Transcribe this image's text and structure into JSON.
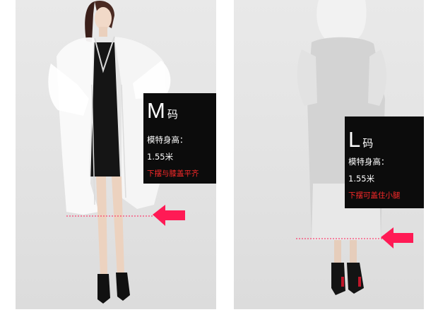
{
  "left_panel": {
    "size_letter": "M",
    "size_unit": "码",
    "height_label": "模特身高：",
    "height_value": "1.55米",
    "note": "下摆与膝盖平齐"
  },
  "right_panel": {
    "size_letter": "L",
    "size_unit": "码",
    "height_label": "模特身高：",
    "height_value": "1.55米",
    "note": "下摆可盖住小腿"
  },
  "colors": {
    "arrow": "#ff1a55",
    "label_bg": "#0c0c0c",
    "note_text": "#ff2a2a"
  }
}
